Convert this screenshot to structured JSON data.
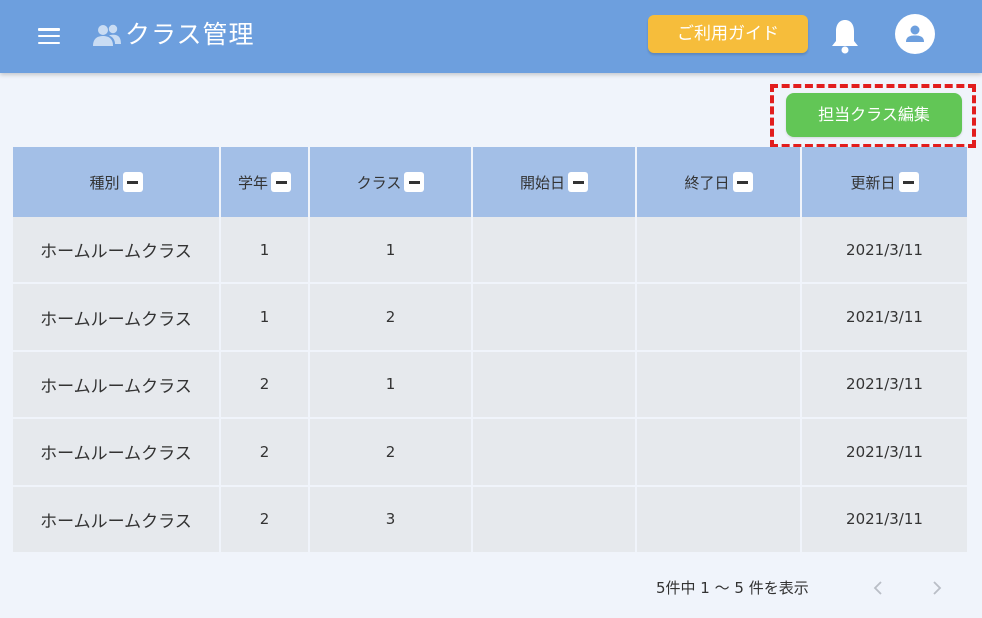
{
  "header": {
    "title": "クラス管理",
    "guide_label": "ご利用ガイド",
    "menu_icon": "hamburger-menu-icon",
    "title_icon": "people-icon",
    "notification_icon": "bell-icon",
    "account_icon": "user-icon"
  },
  "toolbar": {
    "edit_label": "担当クラス編集"
  },
  "table": {
    "columns": [
      "種別",
      "学年",
      "クラス",
      "開始日",
      "終了日",
      "更新日"
    ],
    "rows": [
      [
        "ホームルームクラス",
        "1",
        "1",
        "",
        "",
        "2021/3/11"
      ],
      [
        "ホームルームクラス",
        "1",
        "2",
        "",
        "",
        "2021/3/11"
      ],
      [
        "ホームルームクラス",
        "2",
        "1",
        "",
        "",
        "2021/3/11"
      ],
      [
        "ホームルームクラス",
        "2",
        "2",
        "",
        "",
        "2021/3/11"
      ],
      [
        "ホームルームクラス",
        "2",
        "3",
        "",
        "",
        "2021/3/11"
      ]
    ]
  },
  "pagination": {
    "summary": "5件中 1 ～ 5 件を表示",
    "prev_icon": "chevron-left-icon",
    "next_icon": "chevron-right-icon"
  },
  "colors": {
    "header_bg": "#6d9fde",
    "guide_button": "#f6bd3b",
    "edit_button": "#62c656",
    "table_header": "#a3bfe7",
    "table_cell": "#e6e9ed",
    "highlight": "#e21d1d"
  }
}
